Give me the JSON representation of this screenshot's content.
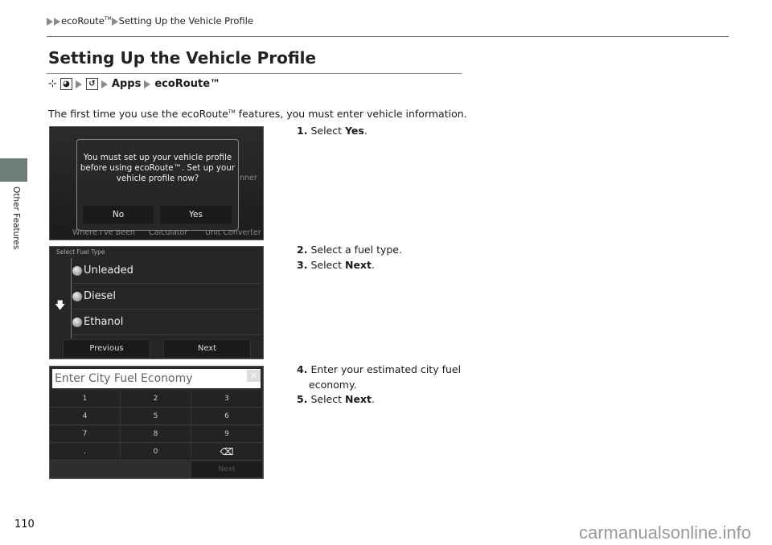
{
  "breadcrumb": {
    "section": "ecoRoute",
    "tm": "TM",
    "page": "Setting Up the Vehicle Profile"
  },
  "side_tab": {
    "label": "Other Features",
    "color": "#6e7d7a"
  },
  "title": "Setting Up the Vehicle Profile",
  "nav_path": {
    "items": [
      "Apps",
      "ecoRoute™"
    ]
  },
  "intro": {
    "before": "The first time you use the ecoRoute",
    "tm": "TM",
    "after": " features, you must enter vehicle information."
  },
  "screen1": {
    "message": "You must set up your vehicle profile before using ecoRoute™. Set up your vehicle profile now?",
    "no_label": "No",
    "yes_label": "Yes",
    "background_labels": [
      "Where I've Been",
      "Calculator",
      "Unit Converter",
      "nner"
    ]
  },
  "screen2": {
    "header": "Select Fuel Type",
    "options": [
      "Unleaded",
      "Diesel",
      "Ethanol"
    ],
    "previous_label": "Previous",
    "next_label": "Next"
  },
  "screen3": {
    "placeholder": "Enter City Fuel Economy",
    "keys": [
      "1",
      "2",
      "3",
      "4",
      "5",
      "6",
      "7",
      "8",
      "9",
      ".",
      "0",
      "⌫"
    ],
    "next_label": "Next"
  },
  "steps": [
    {
      "num": "1.",
      "text": "Select ",
      "bold": "Yes",
      "end": "."
    },
    {
      "num": "2.",
      "text": "Select a fuel type.",
      "bold": "",
      "end": ""
    },
    {
      "num": "3.",
      "text": "Select ",
      "bold": "Next",
      "end": "."
    },
    {
      "num": "4.",
      "text": "Enter your estimated city fuel economy.",
      "bold": "",
      "end": ""
    },
    {
      "num": "5.",
      "text": "Select ",
      "bold": "Next",
      "end": "."
    }
  ],
  "page_number": "110",
  "watermark": "carmanualsonline.info"
}
